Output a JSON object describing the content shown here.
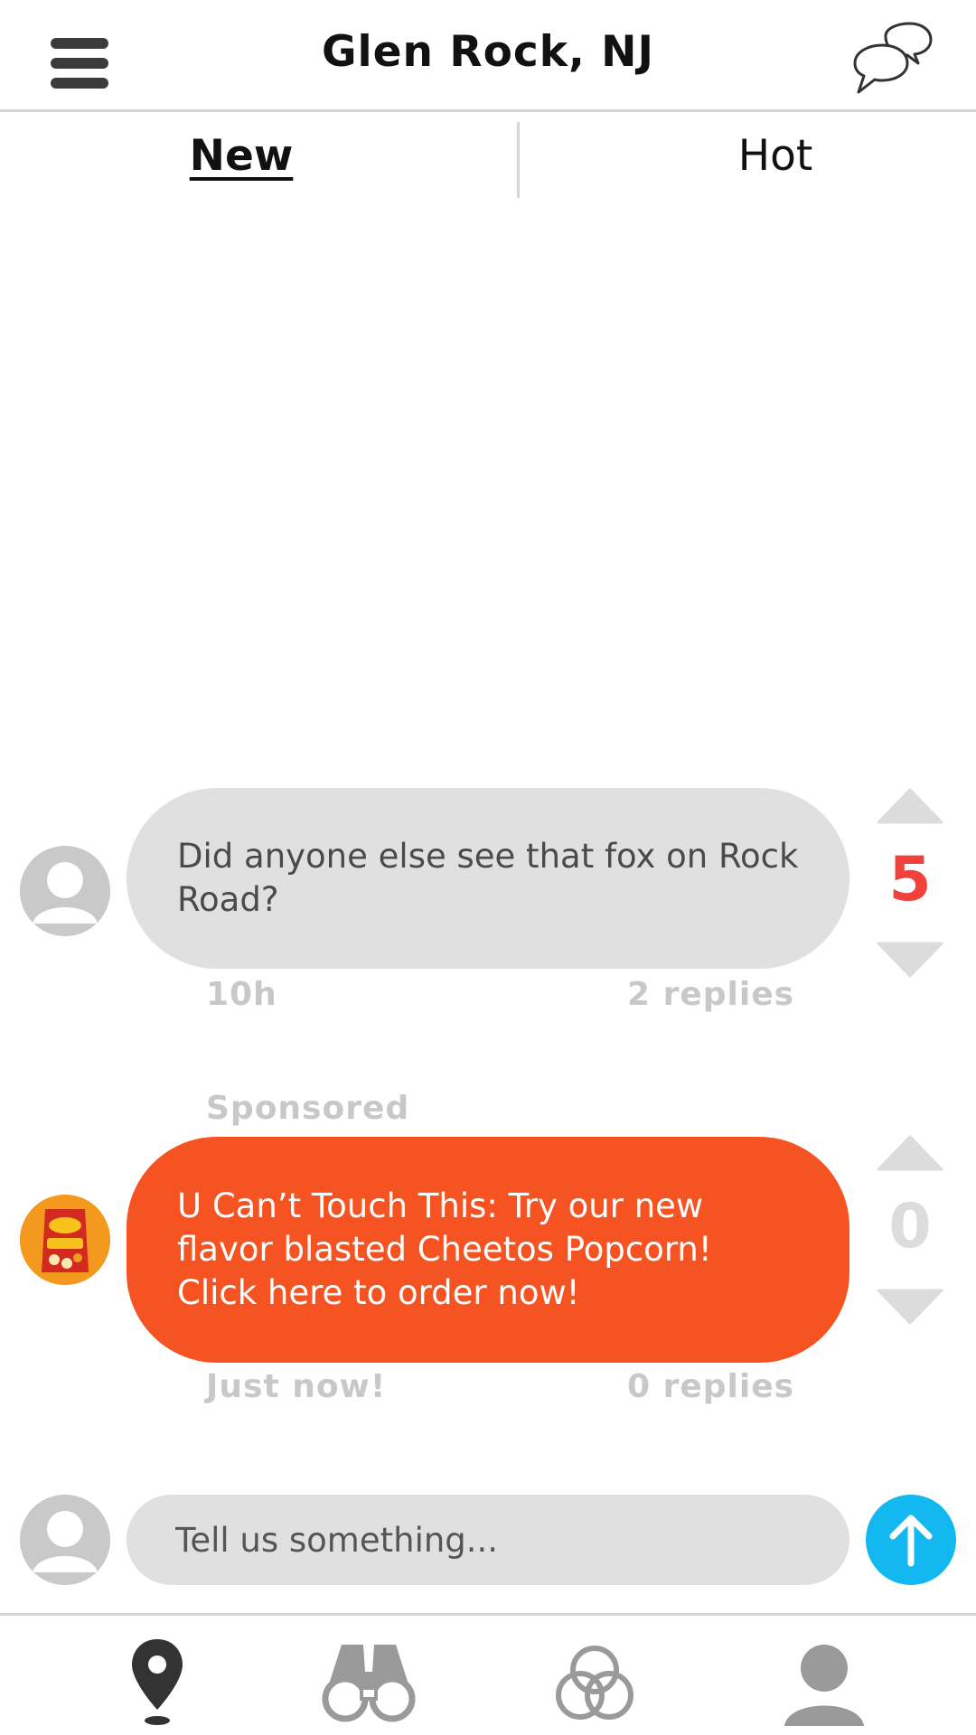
{
  "header": {
    "title": "Glen Rock, NJ",
    "menu_icon": "hamburger-menu-icon",
    "chat_icon": "chat-bubbles-icon"
  },
  "tabs": [
    {
      "label": "New",
      "active": true
    },
    {
      "label": "Hot",
      "active": false
    }
  ],
  "posts": [
    {
      "sponsored_label": "",
      "text": "Did anyone else see that fox on Rock Road?",
      "time": "10h",
      "replies": "2 replies",
      "votes": "5",
      "vote_color": "#f0413b",
      "bubble_color": "#e0e0e0",
      "avatar": "default-user-avatar"
    },
    {
      "sponsored_label": "Sponsored",
      "text": "U Can’t Touch This: Try our new flavor blasted Cheetos Popcorn! Click here to order now!",
      "time": "Just now!",
      "replies": "0 replies",
      "votes": "0",
      "vote_color": "#dcdcdc",
      "bubble_color": "#f55322",
      "avatar": "cheetos-popcorn-avatar"
    }
  ],
  "compose": {
    "placeholder": "Tell us something...",
    "send_icon": "arrow-up-icon",
    "send_color": "#14b8f1"
  },
  "bottom_nav": [
    {
      "icon": "location-pin-icon",
      "active": true
    },
    {
      "icon": "binoculars-icon",
      "active": false
    },
    {
      "icon": "interlocking-rings-icon",
      "active": false
    },
    {
      "icon": "profile-icon",
      "active": false
    }
  ],
  "colors": {
    "accent_orange": "#f55322",
    "accent_blue": "#14b8f1",
    "vote_red": "#f0413b",
    "muted_grey": "#c8c8c8"
  }
}
